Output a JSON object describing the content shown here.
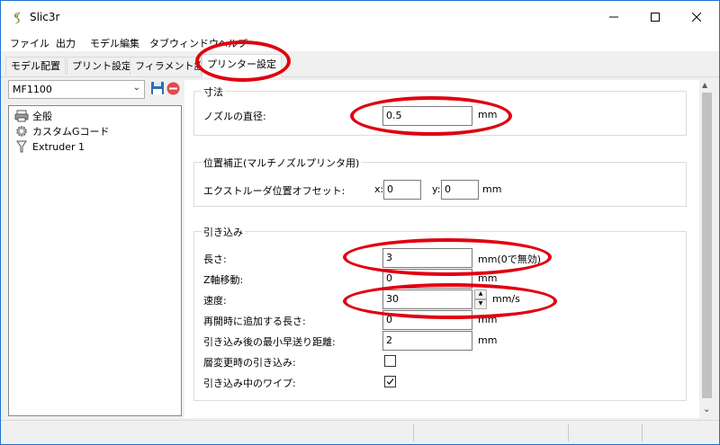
{
  "window": {
    "title": "Slic3r"
  },
  "menu": {
    "items": [
      "ファイル",
      "出力",
      "モデル編集",
      "タブウィンドウ",
      "ヘルプ"
    ]
  },
  "tabs": [
    {
      "label": "モデル配置",
      "active": false
    },
    {
      "label": "プリント設定",
      "active": false
    },
    {
      "label": "フィラメント設定",
      "active": false
    },
    {
      "label": "プリンター設定",
      "active": true
    }
  ],
  "preset": {
    "value": "MF1100"
  },
  "tree": {
    "items": [
      "全般",
      "カスタムGコード",
      "Extruder 1"
    ]
  },
  "dimensions": {
    "title": "寸法",
    "nozzle_label": "ノズルの直径:",
    "nozzle_value": "0.5",
    "nozzle_unit": "mm"
  },
  "offset": {
    "title": "位置補正(マルチノズルプリンタ用)",
    "label": "エクストルーダ位置オフセット:",
    "x_label": "x:",
    "x_value": "0",
    "y_label": "y:",
    "y_value": "0",
    "unit": "mm"
  },
  "retraction": {
    "title": "引き込み",
    "length_label": "長さ:",
    "length_value": "3",
    "length_unit": "mm(0で無効)",
    "zlift_label": "Z軸移動:",
    "zlift_value": "0",
    "zlift_unit": "mm",
    "speed_label": "速度:",
    "speed_value": "30",
    "speed_unit": "mm/s",
    "restart_label": "再開時に追加する長さ:",
    "restart_value": "0",
    "restart_unit": "mm",
    "min_travel_label": "引き込み後の最小早送り距離:",
    "min_travel_value": "2",
    "min_travel_unit": "mm",
    "layer_change_label": "層変更時の引き込み:",
    "layer_change_checked": false,
    "wipe_label": "引き込み中のワイプ:",
    "wipe_checked": true
  },
  "colors": {
    "highlight": "#e00010",
    "accent": "#1e73d0"
  }
}
